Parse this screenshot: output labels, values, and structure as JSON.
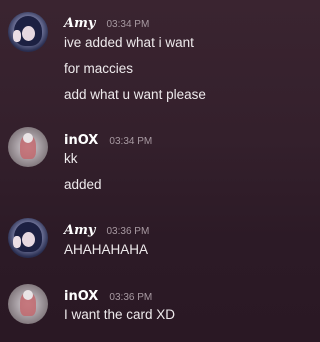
{
  "messages": [
    {
      "author": "Amy",
      "time": "03:34 PM",
      "lines": [
        "ive added what i want",
        "for maccies",
        "add what u want please"
      ]
    },
    {
      "author": "inOX",
      "time": "03:34 PM",
      "lines": [
        "kk",
        "added"
      ]
    },
    {
      "author": "Amy",
      "time": "03:36 PM",
      "lines": [
        "AHAHAHAHA"
      ]
    },
    {
      "author": "inOX",
      "time": "03:36 PM",
      "lines": [
        "I want the card XD"
      ]
    }
  ],
  "colors": {
    "background": "#34202c",
    "text": "#eeeaec",
    "timestamp": "#a89aa2"
  },
  "icons": {
    "amy_avatar": "avatar-icon",
    "inox_avatar": "avatar-icon"
  }
}
